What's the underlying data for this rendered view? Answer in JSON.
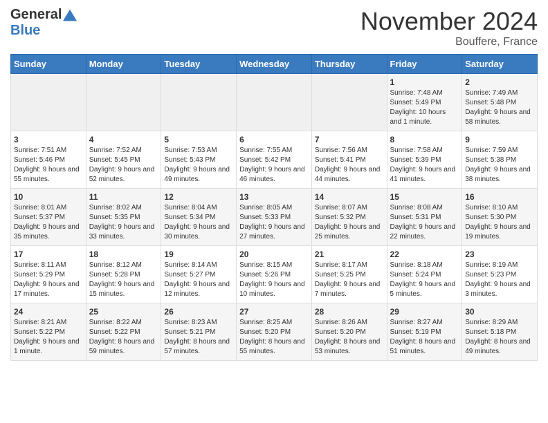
{
  "header": {
    "logo_general": "General",
    "logo_blue": "Blue",
    "month_title": "November 2024",
    "location": "Bouffere, France"
  },
  "days_of_week": [
    "Sunday",
    "Monday",
    "Tuesday",
    "Wednesday",
    "Thursday",
    "Friday",
    "Saturday"
  ],
  "weeks": [
    [
      {
        "day": "",
        "info": ""
      },
      {
        "day": "",
        "info": ""
      },
      {
        "day": "",
        "info": ""
      },
      {
        "day": "",
        "info": ""
      },
      {
        "day": "",
        "info": ""
      },
      {
        "day": "1",
        "info": "Sunrise: 7:48 AM\nSunset: 5:49 PM\nDaylight: 10 hours and 1 minute."
      },
      {
        "day": "2",
        "info": "Sunrise: 7:49 AM\nSunset: 5:48 PM\nDaylight: 9 hours and 58 minutes."
      }
    ],
    [
      {
        "day": "3",
        "info": "Sunrise: 7:51 AM\nSunset: 5:46 PM\nDaylight: 9 hours and 55 minutes."
      },
      {
        "day": "4",
        "info": "Sunrise: 7:52 AM\nSunset: 5:45 PM\nDaylight: 9 hours and 52 minutes."
      },
      {
        "day": "5",
        "info": "Sunrise: 7:53 AM\nSunset: 5:43 PM\nDaylight: 9 hours and 49 minutes."
      },
      {
        "day": "6",
        "info": "Sunrise: 7:55 AM\nSunset: 5:42 PM\nDaylight: 9 hours and 46 minutes."
      },
      {
        "day": "7",
        "info": "Sunrise: 7:56 AM\nSunset: 5:41 PM\nDaylight: 9 hours and 44 minutes."
      },
      {
        "day": "8",
        "info": "Sunrise: 7:58 AM\nSunset: 5:39 PM\nDaylight: 9 hours and 41 minutes."
      },
      {
        "day": "9",
        "info": "Sunrise: 7:59 AM\nSunset: 5:38 PM\nDaylight: 9 hours and 38 minutes."
      }
    ],
    [
      {
        "day": "10",
        "info": "Sunrise: 8:01 AM\nSunset: 5:37 PM\nDaylight: 9 hours and 35 minutes."
      },
      {
        "day": "11",
        "info": "Sunrise: 8:02 AM\nSunset: 5:35 PM\nDaylight: 9 hours and 33 minutes."
      },
      {
        "day": "12",
        "info": "Sunrise: 8:04 AM\nSunset: 5:34 PM\nDaylight: 9 hours and 30 minutes."
      },
      {
        "day": "13",
        "info": "Sunrise: 8:05 AM\nSunset: 5:33 PM\nDaylight: 9 hours and 27 minutes."
      },
      {
        "day": "14",
        "info": "Sunrise: 8:07 AM\nSunset: 5:32 PM\nDaylight: 9 hours and 25 minutes."
      },
      {
        "day": "15",
        "info": "Sunrise: 8:08 AM\nSunset: 5:31 PM\nDaylight: 9 hours and 22 minutes."
      },
      {
        "day": "16",
        "info": "Sunrise: 8:10 AM\nSunset: 5:30 PM\nDaylight: 9 hours and 19 minutes."
      }
    ],
    [
      {
        "day": "17",
        "info": "Sunrise: 8:11 AM\nSunset: 5:29 PM\nDaylight: 9 hours and 17 minutes."
      },
      {
        "day": "18",
        "info": "Sunrise: 8:12 AM\nSunset: 5:28 PM\nDaylight: 9 hours and 15 minutes."
      },
      {
        "day": "19",
        "info": "Sunrise: 8:14 AM\nSunset: 5:27 PM\nDaylight: 9 hours and 12 minutes."
      },
      {
        "day": "20",
        "info": "Sunrise: 8:15 AM\nSunset: 5:26 PM\nDaylight: 9 hours and 10 minutes."
      },
      {
        "day": "21",
        "info": "Sunrise: 8:17 AM\nSunset: 5:25 PM\nDaylight: 9 hours and 7 minutes."
      },
      {
        "day": "22",
        "info": "Sunrise: 8:18 AM\nSunset: 5:24 PM\nDaylight: 9 hours and 5 minutes."
      },
      {
        "day": "23",
        "info": "Sunrise: 8:19 AM\nSunset: 5:23 PM\nDaylight: 9 hours and 3 minutes."
      }
    ],
    [
      {
        "day": "24",
        "info": "Sunrise: 8:21 AM\nSunset: 5:22 PM\nDaylight: 9 hours and 1 minute."
      },
      {
        "day": "25",
        "info": "Sunrise: 8:22 AM\nSunset: 5:22 PM\nDaylight: 8 hours and 59 minutes."
      },
      {
        "day": "26",
        "info": "Sunrise: 8:23 AM\nSunset: 5:21 PM\nDaylight: 8 hours and 57 minutes."
      },
      {
        "day": "27",
        "info": "Sunrise: 8:25 AM\nSunset: 5:20 PM\nDaylight: 8 hours and 55 minutes."
      },
      {
        "day": "28",
        "info": "Sunrise: 8:26 AM\nSunset: 5:20 PM\nDaylight: 8 hours and 53 minutes."
      },
      {
        "day": "29",
        "info": "Sunrise: 8:27 AM\nSunset: 5:19 PM\nDaylight: 8 hours and 51 minutes."
      },
      {
        "day": "30",
        "info": "Sunrise: 8:29 AM\nSunset: 5:18 PM\nDaylight: 8 hours and 49 minutes."
      }
    ]
  ],
  "accent_color": "#3a7abf"
}
